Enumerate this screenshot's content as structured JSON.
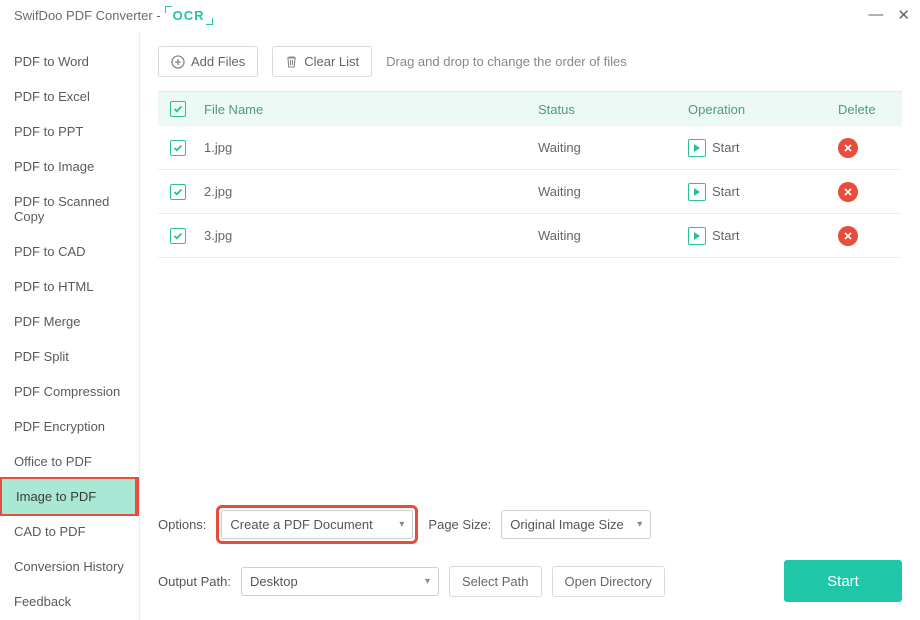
{
  "titlebar": {
    "app": "SwifDoo PDF Converter -",
    "ocr": "OCR"
  },
  "sidebar": {
    "items": [
      "PDF to Word",
      "PDF to Excel",
      "PDF to PPT",
      "PDF to Image",
      "PDF to Scanned Copy",
      "PDF to CAD",
      "PDF to HTML",
      "PDF Merge",
      "PDF Split",
      "PDF Compression",
      "PDF Encryption",
      "Office to PDF",
      "Image to PDF",
      "CAD to PDF",
      "Conversion History",
      "Feedback"
    ],
    "selected_index": 12
  },
  "toolbar": {
    "add_files": "Add Files",
    "clear_list": "Clear List",
    "hint": "Drag and drop to change the order of files"
  },
  "table": {
    "columns": {
      "file": "File Name",
      "status": "Status",
      "operation": "Operation",
      "delete": "Delete"
    },
    "start_label": "Start",
    "rows": [
      {
        "checked": true,
        "file": "1.jpg",
        "status": "Waiting"
      },
      {
        "checked": true,
        "file": "2.jpg",
        "status": "Waiting"
      },
      {
        "checked": true,
        "file": "3.jpg",
        "status": "Waiting"
      }
    ]
  },
  "footer": {
    "options_label": "Options:",
    "options_value": "Create a PDF Document",
    "pagesize_label": "Page Size:",
    "pagesize_value": "Original Image Size",
    "output_label": "Output Path:",
    "output_value": "Desktop",
    "select_path": "Select Path",
    "open_dir": "Open Directory",
    "start": "Start"
  }
}
